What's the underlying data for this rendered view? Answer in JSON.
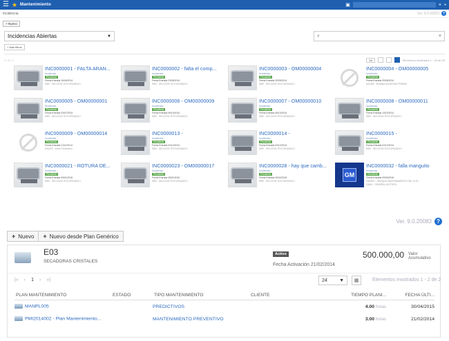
{
  "top": {
    "app_title": "Mantenimiento",
    "breadcrumb": "Incidencia",
    "version": "Ver. 9.0.20003",
    "help": "?",
    "nuevo_label": "+ Nuevo",
    "filter_value": "Incidencias Abiertas",
    "search_placeholder": "",
    "search_icon": "⌕",
    "mas_label": "+ Más filtros",
    "pager_glyphs": "« ‹ 1 › »",
    "page_size": "24",
    "shown_text": "Elementos mostrados 1 - 20 de 20",
    "cards": [
      {
        "title": "INC0000001 - FALTA ARAN...",
        "sub": "Incidencia",
        "status": "Pendiente",
        "date": "Fecha Entrada 16/06/2014",
        "loc": "SBR - SECCION TEXTURIZADO I",
        "thumb": "machine"
      },
      {
        "title": "INC0000002 - falta el comp...",
        "sub": "Incidencia",
        "status": "Pendiente",
        "date": "Fecha Entrada 23/06/2014",
        "loc": "SBR - SECCION TEXTURIZADO I",
        "thumb": "machine"
      },
      {
        "title": "INC0000003 - OM00000004",
        "sub": "Incidencia",
        "status": "Pendiente",
        "date": "Fecha Entrada 30/05/2014",
        "loc": "SBR - SECCION TEXTURIZADO I",
        "thumb": "machine"
      },
      {
        "title": "INC0000004 - OM00000005",
        "sub": "Incidencia",
        "status": "Pendiente",
        "date": "Fecha Entrada 09/06/2014",
        "loc": "A00480 - BOBINA MATERIAS PRIMAS",
        "thumb": "noimg"
      },
      {
        "title": "INC0000005 - OM00000001",
        "sub": "Incidencia",
        "status": "Pendiente",
        "date": "Fecha Entrada 03/07/2014",
        "loc": "SBR - SECCION TEXTURIZADO I",
        "thumb": "machine"
      },
      {
        "title": "INC0000006 - OM00000009",
        "sub": "Incidencia",
        "status": "Pendiente",
        "date": "Fecha Entrada 06/10/2014",
        "loc": "SBR - SECCION TEXTURIZADO I",
        "thumb": "machine"
      },
      {
        "title": "INC0000007 - OM00000010",
        "sub": "Incidencia",
        "status": "Pendiente",
        "date": "Fecha Entrada 06/10/2014",
        "loc": "SBR - SECCION TEXTURIZADO I",
        "thumb": "machine"
      },
      {
        "title": "INC0000008 - OM00000011",
        "sub": "Incidencia",
        "status": "Pendiente",
        "date": "Fecha Entrada 13/10/2014",
        "loc": "SBR - SECCION TEXTURIZADO I",
        "thumb": "machine"
      },
      {
        "title": "INC0000009 - OM00000014",
        "sub": "Incidencia",
        "status": "Pendiente",
        "date": "Fecha Entrada 21/11/2014",
        "loc": "E00220 - Ertes Preventivo",
        "thumb": "noimg"
      },
      {
        "title": "INC0000013 -",
        "sub": "Incidencia",
        "status": "Pendiente",
        "date": "Fecha Entrada 02/12/2014",
        "loc": "SBR - SECCION TEXTURIZADO I",
        "thumb": "machine"
      },
      {
        "title": "INC0000014 -",
        "sub": "Incidencia",
        "status": "Pendiente",
        "date": "Fecha Entrada 02/12/2014",
        "loc": "SBR - SECCION TEXTURIZADO I",
        "thumb": "machine"
      },
      {
        "title": "INC0000015 -",
        "sub": "Incidencia",
        "status": "Pendiente",
        "date": "Fecha Entrada 02/12/2014",
        "loc": "SBR - SECCION TEXTURIZADO I",
        "thumb": "machine"
      },
      {
        "title": "INC0000021 - ROTURA DE...",
        "sub": "Incidencia",
        "status": "Pendiente",
        "date": "Fecha Entrada 09/01/2015",
        "loc": "SBR - SECCION TEXTURIZADO I",
        "thumb": "machine"
      },
      {
        "title": "INC0000023 - OM00000017",
        "sub": "Incidencia",
        "status": "Pendiente",
        "date": "Fecha Entrada 28/01/2015",
        "loc": "SBR - SECCION TEXTURIZADO I",
        "thumb": "machine"
      },
      {
        "title": "INC0000028 - hay que camb...",
        "sub": "Incidencia",
        "status": "Pendiente",
        "date": "Fecha Entrada 06/02/2015",
        "loc": "SBR - SECCION TEXTURIZADO I",
        "thumb": "machine"
      },
      {
        "title": "INC0000032 - falla manguito",
        "sub": "Incidencia",
        "status": "Pendiente",
        "date": "Fecha Entrada 09/03/2015",
        "loc": "GM0007 - PARQUE MANTENIMIENTO DEL CLIE...",
        "loc2": "GM00 - GENERAL MOTORS",
        "thumb": "gm"
      }
    ]
  },
  "bottom": {
    "version": "Ver. 9.0.20083",
    "help": "?",
    "btn_nuevo": "Nuevo",
    "btn_plan": "Nuevo desde Plan Genérico",
    "plus": "+",
    "equip_code": "E03",
    "equip_name": "SECADORAS CRISTALES",
    "status": "Activo",
    "fecha": "Fecha Activación 21/02/2014",
    "valor": "500.000,00",
    "valor_label": "Valor Acumulativo",
    "pager": [
      "|«",
      "‹",
      "1",
      "›",
      "»|"
    ],
    "page_size": "24",
    "export_icon": "▦",
    "shown": "Elementos mostrados 1 - 2 de 2",
    "columns": [
      "PLAN MANTENIMIENTO",
      "ESTADO",
      "TIPO MANTENIMIENTO",
      "CLIENTE",
      "TIEMPO PLANI...",
      "FECHA ÚLTI..."
    ],
    "rows": [
      {
        "plan": "MANPL005",
        "estado": "",
        "tipo": "PREDICTIVOS",
        "cliente": "",
        "tiempo": "4.00",
        "unit": "horas",
        "fecha": "30/04/2015"
      },
      {
        "plan": "PMI2014002 - Plan Mantenimiento...",
        "estado": "",
        "tipo": "MANTENIMIENTO PREVENTIVO",
        "cliente": "",
        "tiempo": "3.00",
        "unit": "horas",
        "fecha": "21/02/2014"
      }
    ]
  },
  "icons": {
    "menu": "menu-icon",
    "favorite": "star-icon",
    "search": "search-icon",
    "help": "help-icon",
    "export": "export-icon"
  },
  "colors": {
    "appbar": "#1f5fb0",
    "link": "#2d6bbf",
    "status_green": "#5aa84b",
    "help_blue": "#1f6fd1"
  }
}
